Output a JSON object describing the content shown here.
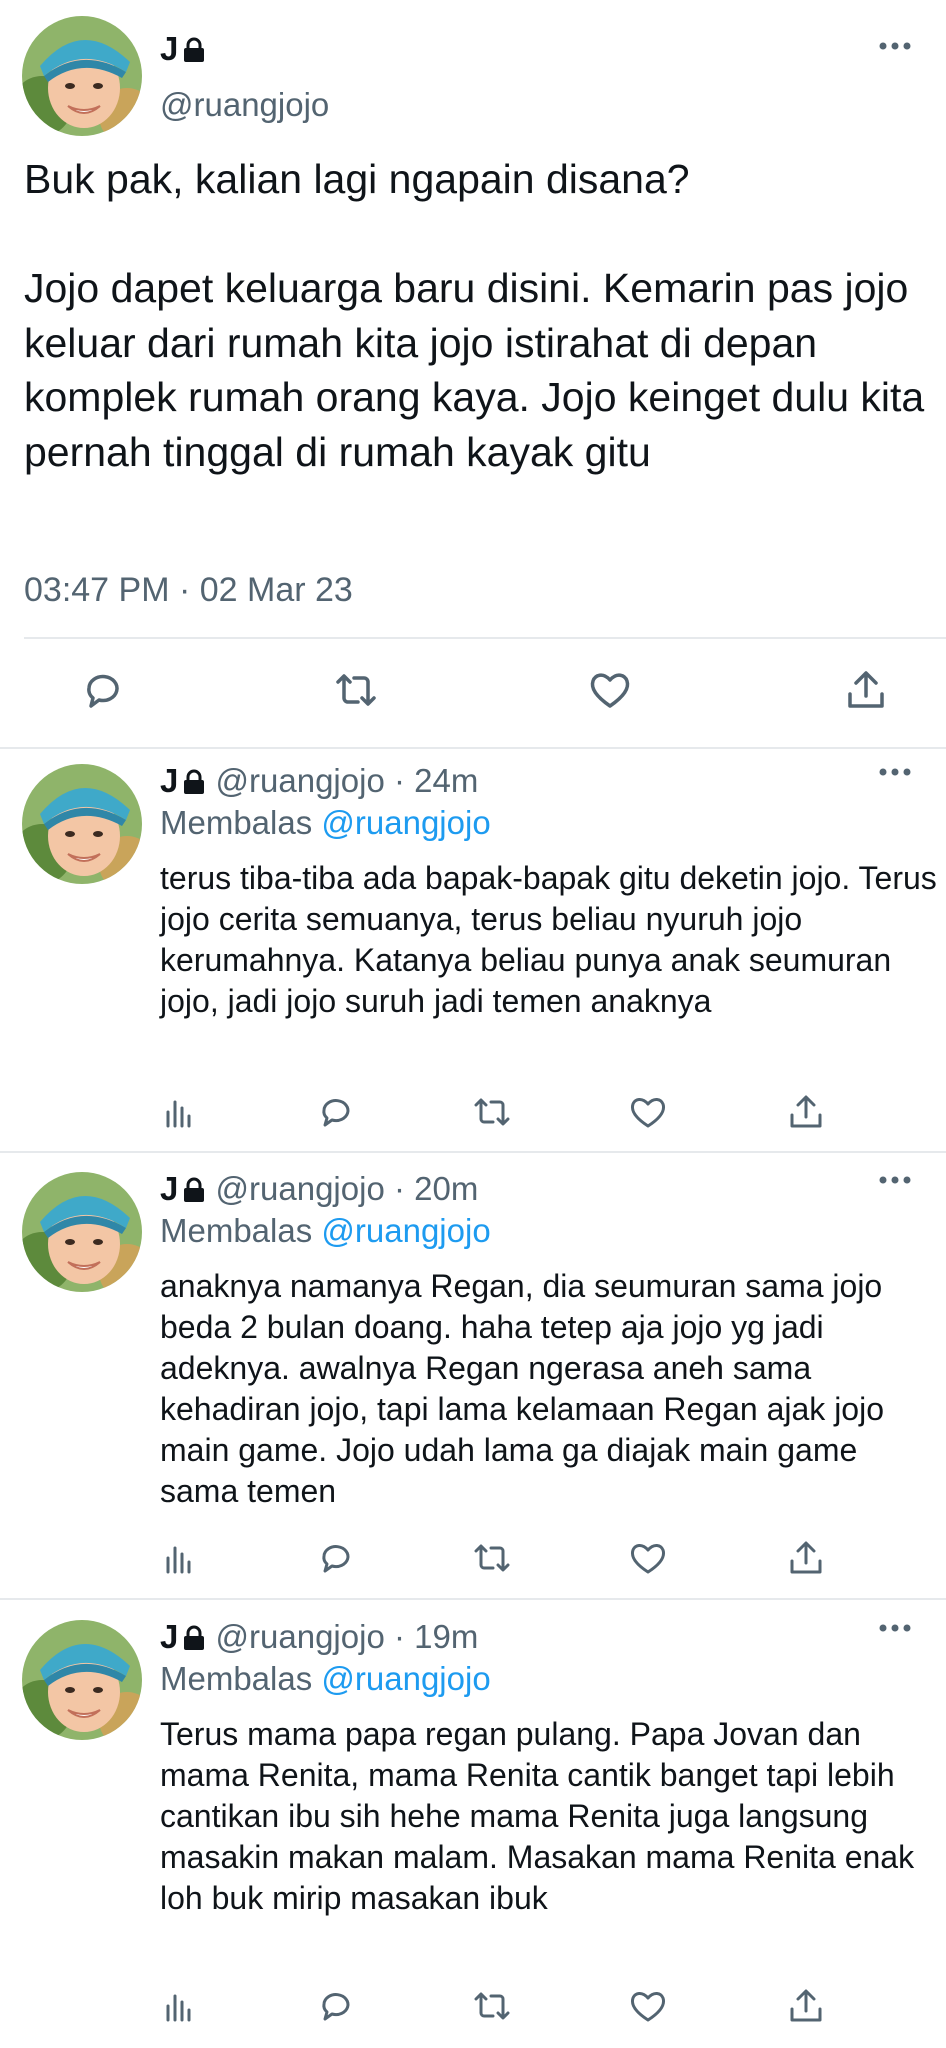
{
  "main_tweet": {
    "name": "J",
    "handle": "@ruangjojo",
    "text": "Buk pak, kalian lagi ngapain disana?\n\nJojo dapet keluarga baru disini. Kemarin pas jojo keluar dari rumah kita jojo istirahat di depan komplek rumah orang kaya. Jojo keinget dulu kita pernah tinggal di rumah kayak gitu",
    "timestamp": "03:47 PM · 02 Mar 23",
    "actions": [
      "reply-icon",
      "retweet-icon",
      "like-icon",
      "share-icon"
    ]
  },
  "replies": [
    {
      "name": "J",
      "handle": "@ruangjojo",
      "time": "· 24m",
      "replying_label": "Membalas",
      "replying_to": "@ruangjojo",
      "text": "terus tiba-tiba ada bapak-bapak gitu deketin jojo. Terus jojo cerita semuanya, terus beliau nyuruh jojo kerumahnya. Katanya beliau punya anak seumuran jojo, jadi jojo suruh jadi temen anaknya"
    },
    {
      "name": "J",
      "handle": "@ruangjojo",
      "time": "· 20m",
      "replying_label": "Membalas",
      "replying_to": "@ruangjojo",
      "text": "anaknya namanya Regan, dia seumuran sama jojo beda 2 bulan doang. haha tetep aja jojo yg jadi adeknya. awalnya Regan ngerasa aneh sama kehadiran jojo, tapi lama kelamaan Regan ajak jojo main game. Jojo udah lama ga diajak main game sama temen"
    },
    {
      "name": "J",
      "handle": "@ruangjojo",
      "time": "· 19m",
      "replying_label": "Membalas",
      "replying_to": "@ruangjojo",
      "text": "Terus mama papa regan pulang. Papa Jovan dan mama Renita, mama Renita cantik banget tapi lebih cantikan ibu sih hehe mama Renita juga langsung masakin makan malam. Masakan mama Renita enak loh buk mirip masakan ibuk"
    }
  ],
  "colors": {
    "text": "#0f1419",
    "muted": "#536471",
    "link": "#1d9bf0",
    "divider": "#e6e9ec",
    "background": "#ffffff"
  }
}
